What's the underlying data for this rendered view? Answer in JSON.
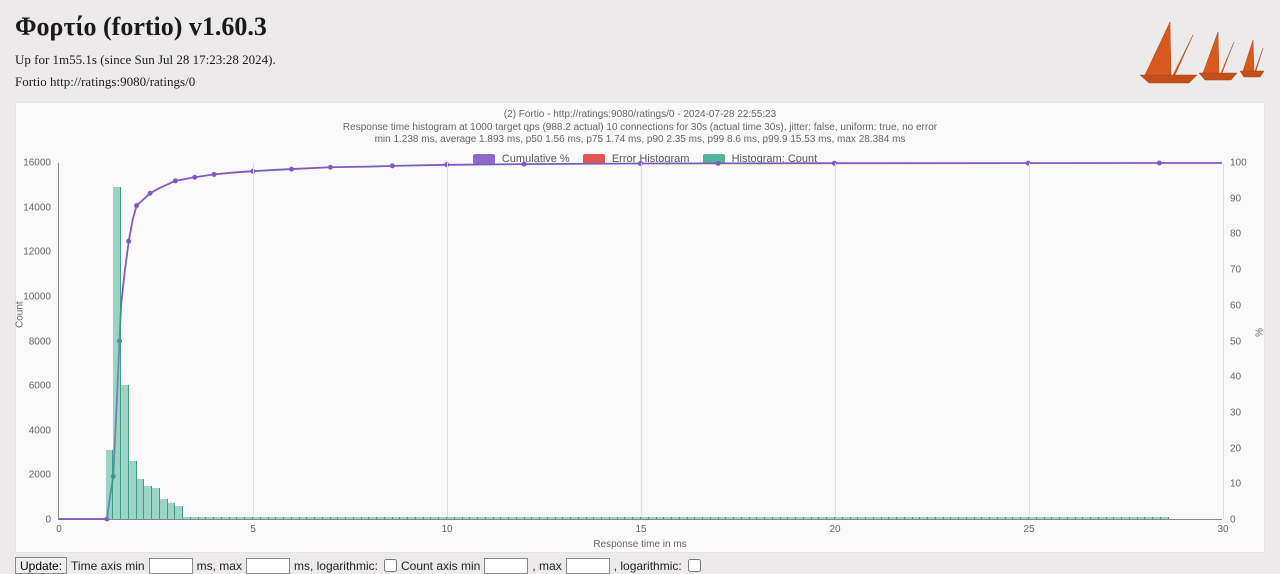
{
  "header": {
    "title": "Φορτίο (fortio) v1.60.3",
    "uptime": "Up for 1m55.1s (since Sun Jul 28 17:23:28 2024).",
    "url_line_prefix": "Fortio ",
    "url": "http://ratings:9080/ratings/0"
  },
  "chart_meta": {
    "title_line1": "(2) Fortio - http://ratings:9080/ratings/0 - 2024-07-28 22:55:23",
    "title_line2": "Response time histogram at 1000 target qps (988.2 actual) 10 connections for 30s (actual time 30s), jitter: false, uniform: true, no error",
    "title_line3": "min 1.238 ms, average 1.893 ms, p50 1.56 ms, p75 1.74 ms, p90 2.35 ms, p99 8.6 ms, p99.9 15.53 ms, max 28.384 ms",
    "x_axis_title": "Response time in ms",
    "y_left_title": "Count",
    "y_right_title": "%",
    "legend": {
      "cumulative": "Cumulative %",
      "error": "Error Histogram",
      "hist": "Histogram: Count"
    }
  },
  "controls": {
    "update": "Update:",
    "time_axis_min": "Time axis min",
    "ms_max": "ms, max",
    "ms_logarithmic": "ms, logarithmic:",
    "count_axis_min": "Count axis min",
    "count_max": ", max",
    "count_logarithmic": ", logarithmic:"
  },
  "chart_data": {
    "type": "histogram+line",
    "x_axis": {
      "min": 0,
      "max": 30,
      "ticks": [
        0,
        5,
        10,
        15,
        20,
        25,
        30
      ],
      "label": "Response time in ms"
    },
    "y_left": {
      "min": 0,
      "max": 16000,
      "ticks": [
        0,
        2000,
        4000,
        6000,
        8000,
        10000,
        12000,
        14000,
        16000
      ],
      "label": "Count"
    },
    "y_right": {
      "min": 0,
      "max": 100,
      "ticks": [
        0,
        10,
        20,
        30,
        40,
        50,
        60,
        70,
        80,
        90,
        100
      ],
      "label": "%"
    },
    "histogram": {
      "bin_width_ms": 0.2,
      "bins_start_ms": [
        1.2,
        1.4,
        1.6,
        1.8,
        2.0,
        2.2,
        2.4,
        2.6,
        2.8,
        3.0
      ],
      "counts": [
        3100,
        14900,
        6000,
        2600,
        1800,
        1500,
        1400,
        900,
        700,
        600
      ]
    },
    "histogram_tail": {
      "from_ms": 3.2,
      "to_ms": 28.4,
      "approx_count_each": 80
    },
    "cumulative_pct": {
      "x_ms": [
        0,
        1.0,
        1.238,
        1.3,
        1.4,
        1.5,
        1.56,
        1.6,
        1.7,
        1.8,
        1.9,
        2.0,
        2.2,
        2.35,
        2.6,
        3.0,
        3.5,
        4.0,
        4.5,
        5.0,
        5.5,
        6.0,
        7.0,
        8.0,
        8.6,
        10.0,
        12.0,
        15.0,
        17.0,
        20.0,
        25.0,
        28.384,
        30.0
      ],
      "pct": [
        0,
        0,
        0,
        5,
        12,
        35,
        50,
        60,
        70,
        78,
        84,
        88,
        90,
        91.5,
        93,
        95,
        96,
        96.8,
        97.3,
        97.7,
        98,
        98.3,
        98.8,
        99,
        99.2,
        99.5,
        99.7,
        99.85,
        99.9,
        99.95,
        99.98,
        100,
        100
      ]
    },
    "cumulative_markers_x_ms": [
      1.238,
      1.4,
      1.56,
      1.8,
      2.0,
      2.4,
      3.0,
      3.5,
      4.0,
      5.0,
      6.0,
      7.0,
      8.6,
      10.0,
      12.0,
      15.0,
      17.0,
      20.0,
      25.0,
      28.384
    ],
    "error_histogram": {
      "counts": []
    }
  }
}
